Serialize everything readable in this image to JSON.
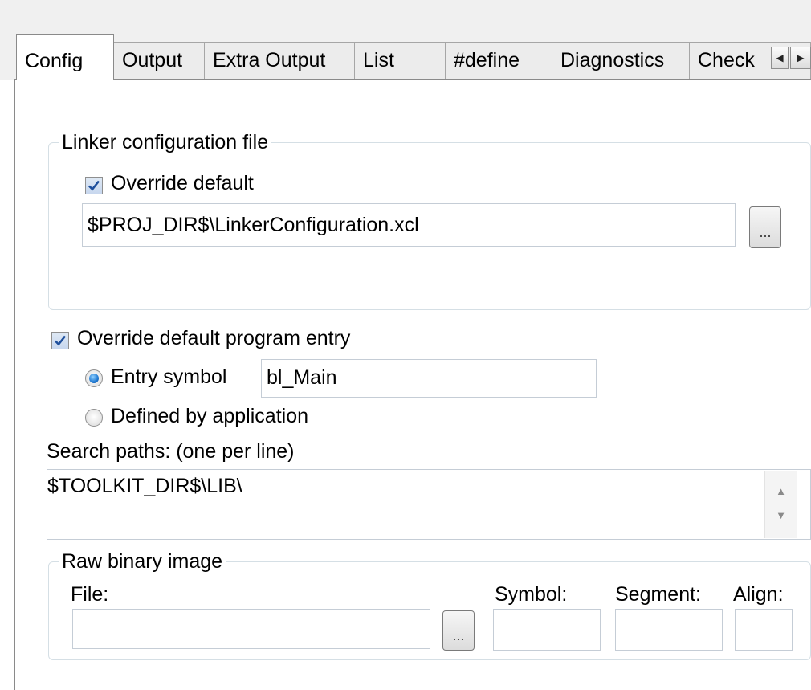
{
  "tabs": [
    {
      "label": "Config",
      "active": true
    },
    {
      "label": "Output",
      "active": false
    },
    {
      "label": "Extra Output",
      "active": false
    },
    {
      "label": "List",
      "active": false
    },
    {
      "label": "#define",
      "active": false
    },
    {
      "label": "Diagnostics",
      "active": false
    },
    {
      "label": "Check",
      "active": false
    }
  ],
  "tab_scroll": {
    "left_icon": "◀",
    "right_icon": "▶"
  },
  "linker_config": {
    "legend": "Linker configuration file",
    "override_label": "Override default",
    "override_checked": true,
    "file_path": "$PROJ_DIR$\\LinkerConfiguration.xcl",
    "browse_label": "..."
  },
  "program_entry": {
    "override_label": "Override default program entry",
    "override_checked": true,
    "entry_symbol_label": "Entry symbol",
    "entry_symbol_value": "bl_Main",
    "defined_by_app_label": "Defined by application",
    "selected": "entry_symbol"
  },
  "search_paths": {
    "label": "Search paths:  (one per line)",
    "value": "$TOOLKIT_DIR$\\LIB\\",
    "scroll_up_icon": "▲",
    "scroll_down_icon": "▼"
  },
  "raw_binary": {
    "legend": "Raw binary image",
    "file_label": "File:",
    "symbol_label": "Symbol:",
    "segment_label": "Segment:",
    "align_label": "Align:",
    "file_value": "",
    "symbol_value": "",
    "segment_value": "",
    "align_value": "",
    "browse_label": "..."
  }
}
